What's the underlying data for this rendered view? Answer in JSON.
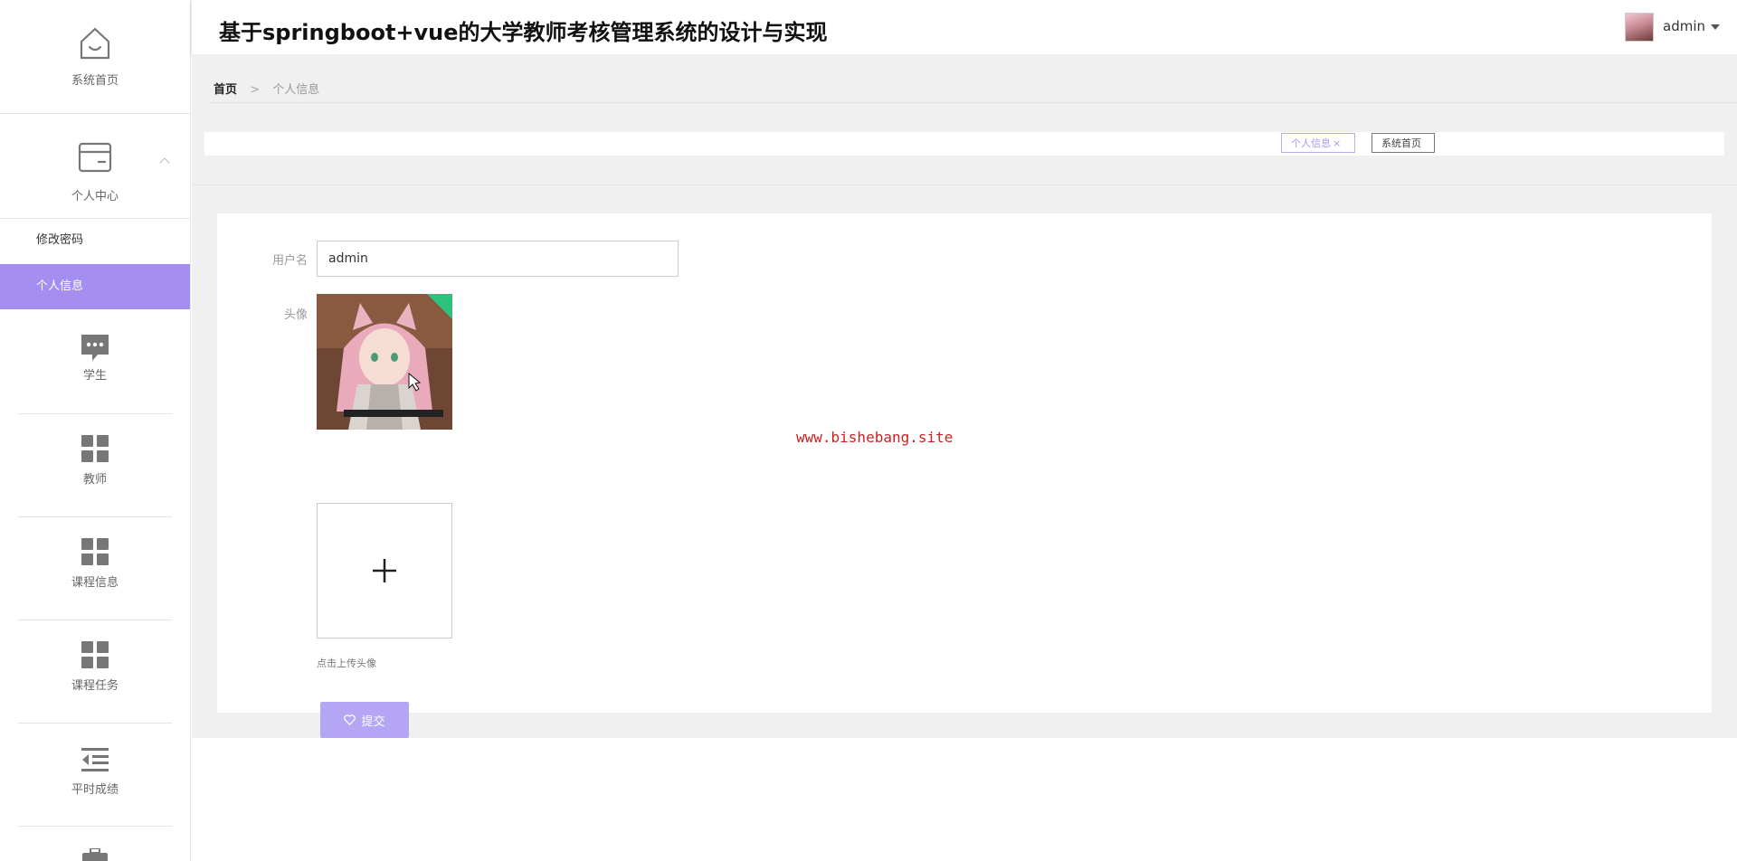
{
  "app": {
    "title": "基于springboot+vue的大学教师考核管理系统的设计与实现"
  },
  "user": {
    "name": "admin"
  },
  "sidebar": {
    "home": "系统首页",
    "personal_center": "个人中心",
    "sub_items": [
      "修改密码",
      "个人信息"
    ],
    "active_sub": "个人信息",
    "items": [
      "学生",
      "教师",
      "课程信息",
      "课程任务",
      "平时成绩"
    ]
  },
  "breadcrumb": {
    "home": "首页",
    "separator": ">",
    "current": "个人信息"
  },
  "tags": [
    {
      "label": "个人信息",
      "close": "×"
    },
    {
      "label": "系统首页"
    }
  ],
  "form": {
    "username_label": "用户名",
    "username_value": "admin",
    "avatar_label": "头像",
    "upload_hint": "点击上传头像",
    "submit_label": "提交"
  },
  "watermark": "www.bishebang.site",
  "colors": {
    "accent": "#a48ef0",
    "button": "#b5a6f5",
    "watermark": "#cc2222"
  }
}
